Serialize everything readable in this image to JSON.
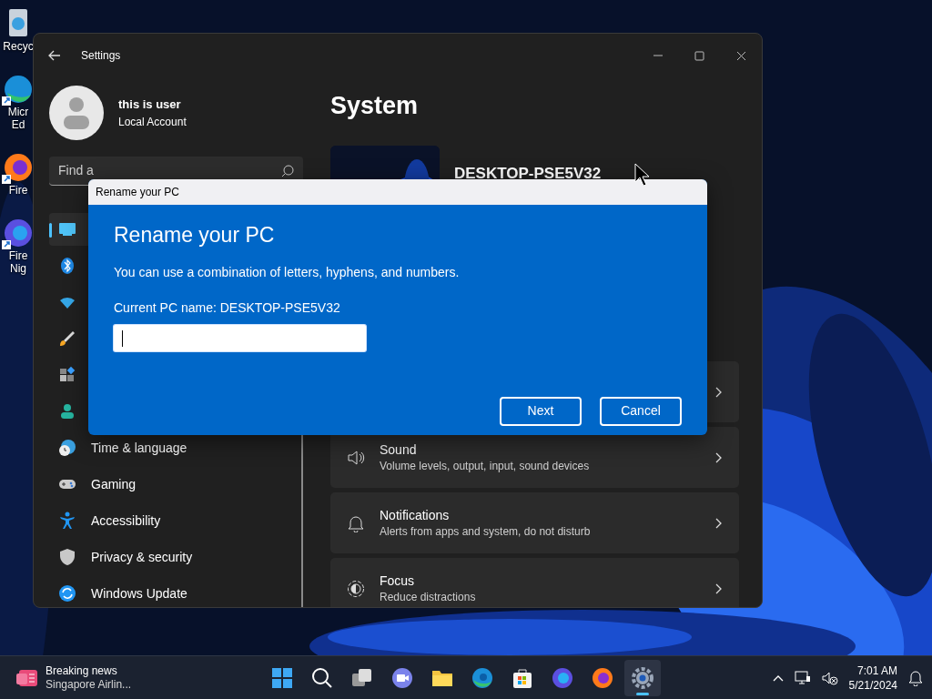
{
  "desktop_icons": [
    {
      "lines": [
        "Recyc"
      ]
    },
    {
      "lines": [
        "Micr",
        "Ed"
      ]
    },
    {
      "lines": [
        "Fire"
      ]
    },
    {
      "lines": [
        "Fire",
        "Nig"
      ]
    }
  ],
  "settings": {
    "title": "Settings",
    "user": {
      "name": "this is user",
      "account": "Local Account"
    },
    "search": {
      "placeholder": "Find a"
    },
    "nav": [
      {
        "selected": true
      },
      {
        "selected": false
      },
      {
        "selected": false
      },
      {
        "selected": false
      },
      {
        "selected": false
      },
      {
        "selected": false
      },
      {
        "label": "Time & language",
        "selected": false
      },
      {
        "label": "Gaming",
        "selected": false
      },
      {
        "label": "Accessibility",
        "selected": false
      },
      {
        "label": "Privacy & security",
        "selected": false
      },
      {
        "label": "Windows Update",
        "selected": false
      }
    ],
    "heading": "System",
    "device_name": "DESKTOP-PSE5V32",
    "cards": [
      {
        "kind": "bare"
      },
      {
        "kind": "labeled",
        "title": "Sound",
        "subtitle": "Volume levels, output, input, sound devices"
      },
      {
        "kind": "labeled",
        "title": "Notifications",
        "subtitle": "Alerts from apps and system, do not disturb"
      },
      {
        "kind": "labeled",
        "title": "Focus",
        "subtitle": "Reduce distractions"
      }
    ]
  },
  "dialog": {
    "title": "Rename your PC",
    "heading": "Rename your PC",
    "text": "You can use a combination of letters, hyphens, and numbers.",
    "current": "Current PC name: DESKTOP-PSE5V32",
    "input": {
      "focused": true
    },
    "buttons": [
      "Next",
      "Cancel"
    ]
  },
  "taskbar": {
    "news": {
      "title": "Breaking news",
      "text": "Singapore Airlin..."
    },
    "apps": [
      {
        "active": false
      },
      {
        "active": false
      },
      {
        "active": false
      },
      {
        "active": false
      },
      {
        "active": false
      },
      {
        "active": false
      },
      {
        "active": false
      },
      {
        "active": false
      },
      {
        "active": false
      },
      {
        "active": true
      }
    ],
    "time": "7:01 AM",
    "date": "5/21/2024"
  }
}
